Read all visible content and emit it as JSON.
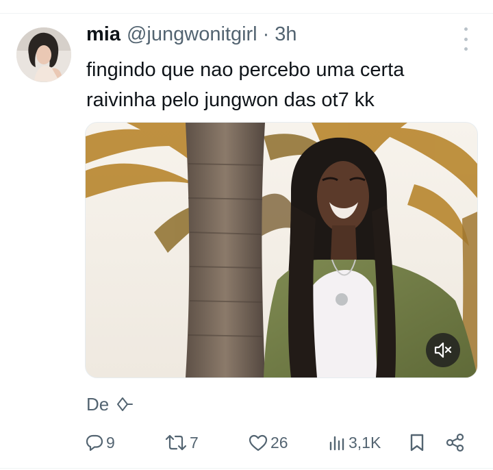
{
  "tweet": {
    "author": {
      "display_name": "mia",
      "handle": "@jungwonitgirl",
      "separator": "·",
      "time": "3h"
    },
    "text_lines": [
      "fingindo que nao percebo uma certa",
      "raivinha pelo jungwon das ot7 kk"
    ],
    "media": {
      "kind": "video",
      "icon": "mute-icon"
    },
    "translate": {
      "label": "De",
      "icon": "translate-sparkle-icon"
    },
    "actions": {
      "replies": "9",
      "reposts": "7",
      "likes": "26",
      "views": "3,1K"
    }
  },
  "colors": {
    "text": "#0f1419",
    "secondary": "#536471",
    "divider": "#eff3f4"
  }
}
